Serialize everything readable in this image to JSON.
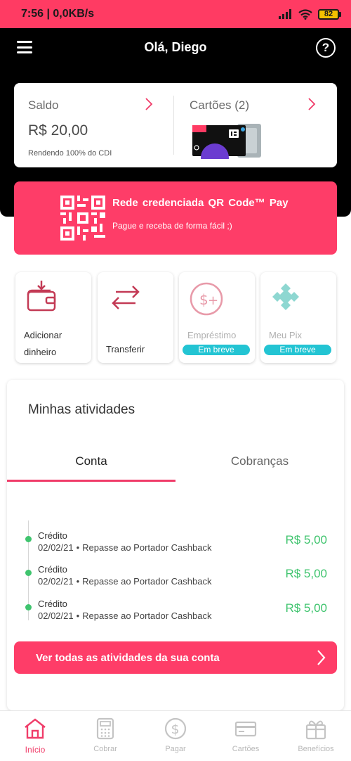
{
  "status_bar": {
    "time_speed": "7:56 | 0,0KB/s",
    "battery": "82"
  },
  "header": {
    "greeting": "Olá, Diego"
  },
  "balance": {
    "label": "Saldo",
    "value": "R$ 20,00",
    "note": "Rendendo 100% do CDI",
    "cards_label": "Cartões (2)"
  },
  "qr_banner": {
    "title": "Rede credenciada  QR Code™  Pay",
    "subtitle": "Pague e receba de forma fácil ;)"
  },
  "actions": [
    {
      "label": "Adicionar dinheiro",
      "icon": "wallet-icon",
      "enabled": true
    },
    {
      "label": "Transferir",
      "icon": "transfer-arrows-icon",
      "enabled": true
    },
    {
      "label": "Empréstimo",
      "icon": "dollar-plus-icon",
      "enabled": false,
      "badge": "Em breve"
    },
    {
      "label": "Meu Pix",
      "icon": "pix-icon",
      "enabled": false,
      "badge": "Em breve"
    }
  ],
  "activities": {
    "title": "Minhas atividades",
    "tabs": [
      "Conta",
      "Cobranças"
    ],
    "active_tab": "Conta",
    "items": [
      {
        "type": "Crédito",
        "date": "02/02/21",
        "description": "Repasse ao Portador Cashback",
        "amount": "R$ 5,00"
      },
      {
        "type": "Crédito",
        "date": "02/02/21",
        "description": "Repasse ao Portador Cashback",
        "amount": "R$ 5,00"
      },
      {
        "type": "Crédito",
        "date": "02/02/21",
        "description": "Repasse ao Portador Cashback",
        "amount": "R$ 5,00"
      }
    ],
    "view_all": "Ver todas as atividades da sua conta"
  },
  "bottom_nav": [
    {
      "label": "Início",
      "icon": "home-icon",
      "active": true
    },
    {
      "label": "Cobrar",
      "icon": "calculator-icon",
      "active": false
    },
    {
      "label": "Pagar",
      "icon": "dollar-circle-icon",
      "active": false
    },
    {
      "label": "Cartões",
      "icon": "card-icon",
      "active": false
    },
    {
      "label": "Benefícios",
      "icon": "gift-icon",
      "active": false
    }
  ],
  "colors": {
    "brand": "#fe3d68",
    "positive": "#3fc46e",
    "badge": "#23c4d3",
    "header": "#000000"
  }
}
